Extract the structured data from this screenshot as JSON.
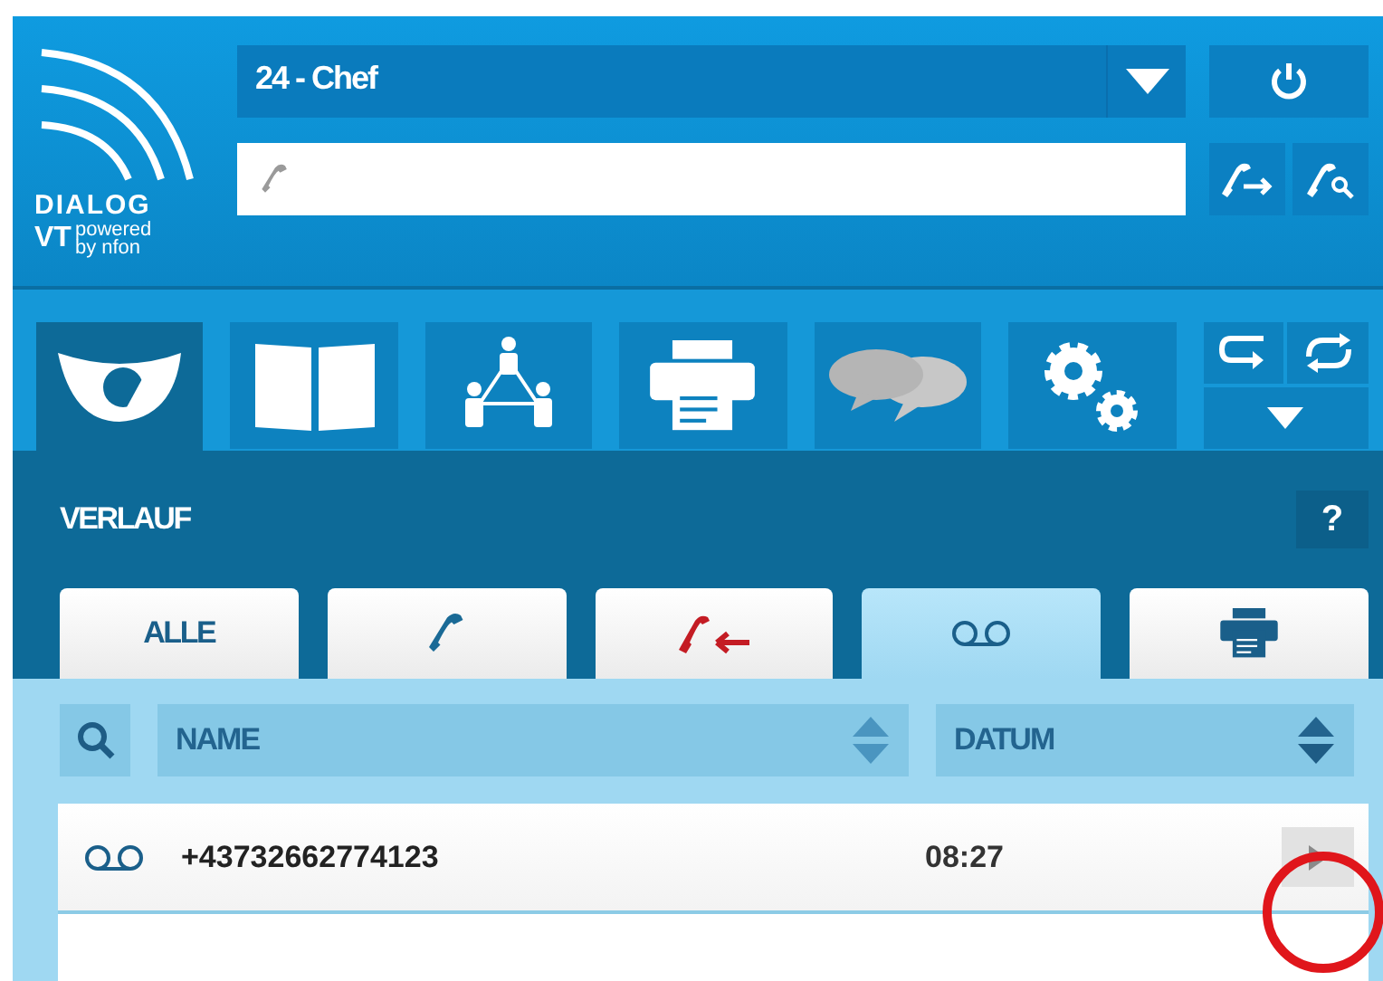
{
  "logo": {
    "brand": "DIALOG",
    "product": "VT",
    "tagline_top": "powered",
    "tagline_bottom": "by nfon"
  },
  "account": {
    "value": "24 - Chef"
  },
  "nav": [
    {
      "kind": "history",
      "selected": true
    },
    {
      "kind": "book",
      "selected": false
    },
    {
      "kind": "team",
      "selected": false
    },
    {
      "kind": "fax",
      "selected": false
    },
    {
      "kind": "chat",
      "selected": false
    },
    {
      "kind": "settings",
      "selected": false
    }
  ],
  "section": {
    "title": "VERLAUF",
    "help": "?"
  },
  "tabs": [
    {
      "kind": "all",
      "label": "ALLE",
      "selected": false
    },
    {
      "kind": "calls",
      "selected": false
    },
    {
      "kind": "missed",
      "selected": false
    },
    {
      "kind": "voicemail",
      "selected": true
    },
    {
      "kind": "fax",
      "selected": false
    }
  ],
  "columns": [
    {
      "label": "NAME"
    },
    {
      "label": "DATUM"
    }
  ],
  "rows": [
    {
      "kind": "voicemail",
      "name": "+43732662774123",
      "date": "08:27"
    }
  ]
}
